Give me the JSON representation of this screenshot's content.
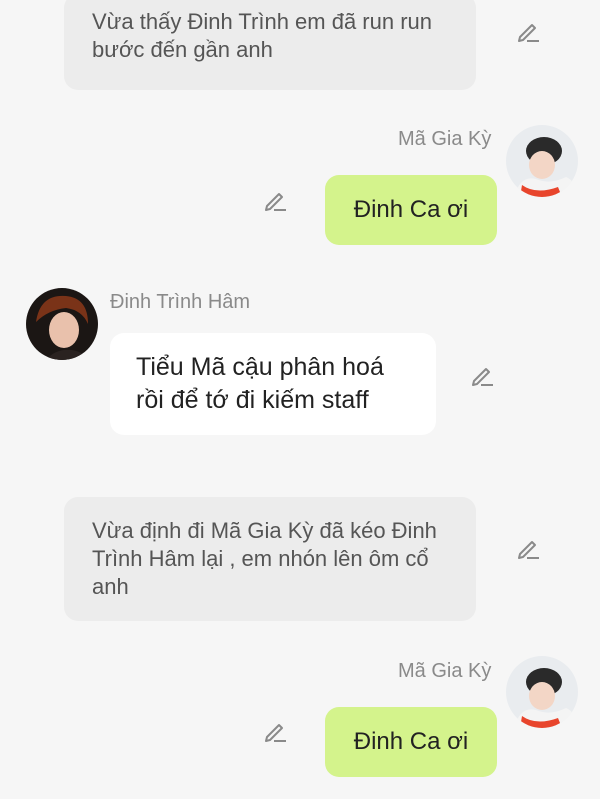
{
  "messages": {
    "narration1": {
      "text": "Vừa thấy Đinh Trình em đã run run bước đến gần anh"
    },
    "right1": {
      "name": "Mã Gia Kỳ",
      "text": "Đinh Ca ơi"
    },
    "left1": {
      "name": "Đinh Trình Hâm",
      "text": "Tiểu Mã cậu phân hoá rồi để tớ đi kiếm staff"
    },
    "narration2": {
      "text": "Vừa định đi Mã Gia Kỳ đã kéo Đinh Trình Hâm lại , em nhón lên ôm cổ anh"
    },
    "right2": {
      "name": "Mã Gia Kỳ",
      "text": "Đinh Ca ơi"
    }
  },
  "colors": {
    "green_bubble": "#d4f38c",
    "narration_bg": "#ececec",
    "page_bg": "#f6f6f6"
  },
  "icons": {
    "edit": "edit-pencil-icon"
  }
}
